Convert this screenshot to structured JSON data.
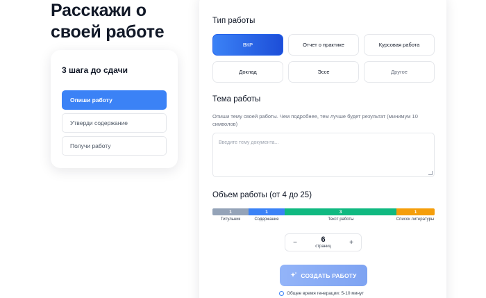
{
  "page": {
    "title": "Расскажи о своей работе"
  },
  "steps": {
    "title": "3 шага до сдачи",
    "items": [
      {
        "label": "Опиши работу",
        "active": true
      },
      {
        "label": "Утверди содержание",
        "active": false
      },
      {
        "label": "Получи работу",
        "active": false
      }
    ]
  },
  "work_type": {
    "title": "Тип работы",
    "options": [
      {
        "label": "ВКР",
        "selected": true
      },
      {
        "label": "Отчет о практике",
        "selected": false
      },
      {
        "label": "Курсовая работа",
        "selected": false
      },
      {
        "label": "Доклад",
        "selected": false
      },
      {
        "label": "Эссе",
        "selected": false
      },
      {
        "label": "Другое",
        "selected": false
      }
    ]
  },
  "topic": {
    "title": "Тема работы",
    "hint": "Опиши тему своей работы. Чем подробнее, тем лучше будет результат (минимум 10 символов)",
    "placeholder": "Введите тему документа..."
  },
  "volume": {
    "title": "Объем работы (от 4 до 25)",
    "segments": [
      {
        "value": "1",
        "label": "Титульник",
        "color": "#94a3b8"
      },
      {
        "value": "1",
        "label": "Содержание",
        "color": "#3b82f6"
      },
      {
        "value": "3",
        "label": "Текст работы",
        "color": "#10b981"
      },
      {
        "value": "1",
        "label": "Список литературы",
        "color": "#f59e0b"
      }
    ],
    "pages": "6",
    "pages_unit": "страниц",
    "minus": "−",
    "plus": "+"
  },
  "create": {
    "label": "СОЗДАТЬ РАБОТУ",
    "icon": "sparkle-icon"
  },
  "note": {
    "text": "Общее время генерации: 5-10 минут",
    "icon": "clock-icon"
  }
}
